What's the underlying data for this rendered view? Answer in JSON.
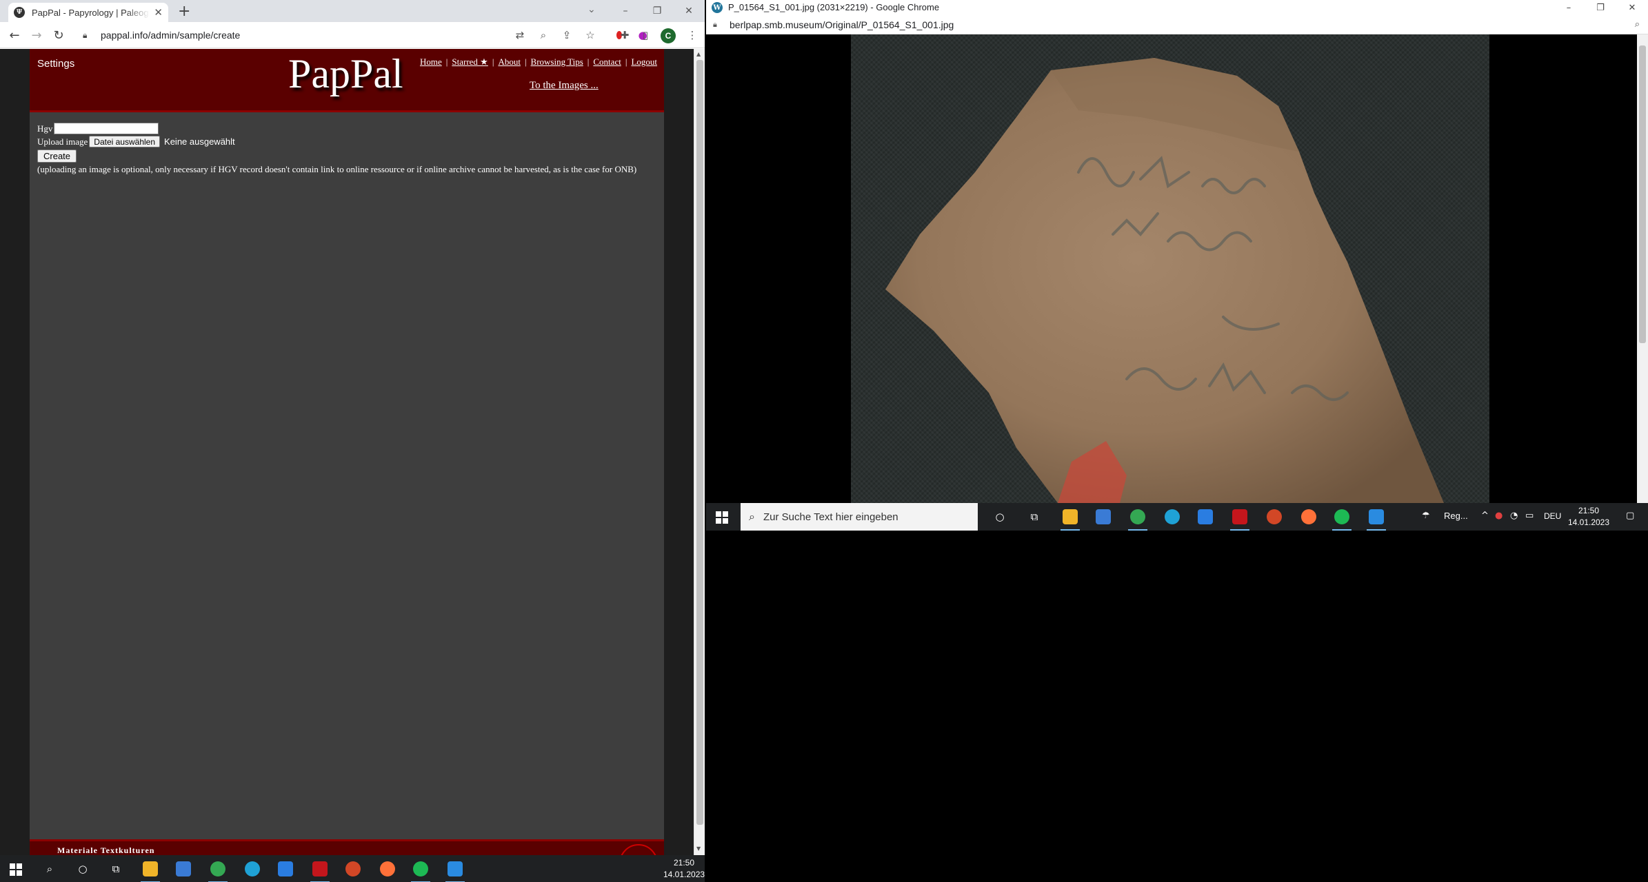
{
  "left_window": {
    "tab_title": "PapPal - Papyrology | Paleography",
    "url": "pappal.info/admin/sample/create",
    "profile_letter": "C",
    "page": {
      "settings_label": "Settings",
      "logo": "PapPal",
      "nav": [
        "Home",
        "Starred ★",
        "About",
        "Browsing Tips",
        "Contact",
        "Logout"
      ],
      "to_images": "To the Images ...",
      "form": {
        "hgv_label": "Hgv",
        "upload_label": "Upload image",
        "choose_file": "Datei auswählen",
        "file_status": "Keine ausgewählt",
        "create_button": "Create",
        "note": "(uploading an image is optional, only necessary if HGV record doesn't contain link to online ressource or if online archive cannot be harvested, as is the case for ONB)"
      },
      "footer_text": "Materiale Textkulturen"
    }
  },
  "right_window": {
    "title": "P_01564_S1_001.jpg (2031×2219) - Google Chrome",
    "url": "berlpap.smb.museum/Original/P_01564_S1_001.jpg",
    "taskbar": {
      "search_placeholder": "Zur Suche Text hier eingeben",
      "weather": "Reg...",
      "language": "DEU",
      "time": "21:50",
      "date": "14.01.2023"
    }
  },
  "taskbar": {
    "time": "21:50",
    "date": "14.01.2023"
  },
  "colors": {
    "header_red": "#5a0000",
    "page_gray": "#3e3e3e",
    "ostracon": "#9a7a5e",
    "backdrop": "#2a302f"
  }
}
